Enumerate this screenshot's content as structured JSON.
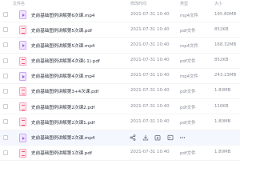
{
  "header": {
    "name": "文件名",
    "date": "修改时间",
    "type": "类型",
    "size": "大小"
  },
  "files": [
    {
      "name": "史前基础图例讲解第6次课.mp4",
      "date": "2021-07-31 10:40",
      "type": "mp4文件",
      "size": "195.80MB",
      "kind": "mp4"
    },
    {
      "name": "史前基础图例讲解第5次课.pdf",
      "date": "2021-07-31 10:40",
      "type": "pdf文件",
      "size": "852KB",
      "kind": "pdf"
    },
    {
      "name": "史前基础图例讲解第5次课.mp4",
      "date": "2021-07-31 10:40",
      "type": "mp4文件",
      "size": "168.32MB",
      "kind": "mp4"
    },
    {
      "name": "史前基础图例讲解第4次课(-1).pdf",
      "date": "2021-07-31 10:40",
      "type": "pdf文件",
      "size": "852KB",
      "kind": "pdf"
    },
    {
      "name": "史前基础图例讲解第4次课.mp4",
      "date": "2021-07-31 10:40",
      "type": "mp4文件",
      "size": "243.23MB",
      "kind": "mp4"
    },
    {
      "name": "史前基础图例讲解第3+4次课.pdf",
      "date": "2021-07-31 10:40",
      "type": "pdf文件",
      "size": "1.80MB",
      "kind": "pdf"
    },
    {
      "name": "史前基础图例讲解第2次课2.pdf",
      "date": "2021-07-31 10:40",
      "type": "pdf文件",
      "size": "110KB",
      "kind": "pdf"
    },
    {
      "name": "史前基础图例讲解第2次课1.pdf",
      "date": "2021-07-31 10:40",
      "type": "pdf文件",
      "size": "1.80MB",
      "kind": "pdf"
    },
    {
      "name": "史前基础图例讲解第2次课.mp4",
      "date": "",
      "type": "",
      "size": "",
      "kind": "mp4",
      "hover": true
    },
    {
      "name": "史前基础图例讲解第1次课.pdf",
      "date": "2021-07-31 10:40",
      "type": "pdf文件",
      "size": "1.80MB",
      "kind": "pdf"
    }
  ],
  "row_actions": [
    "share-icon",
    "download-icon",
    "copy-icon",
    "move-icon",
    "more-icon"
  ]
}
